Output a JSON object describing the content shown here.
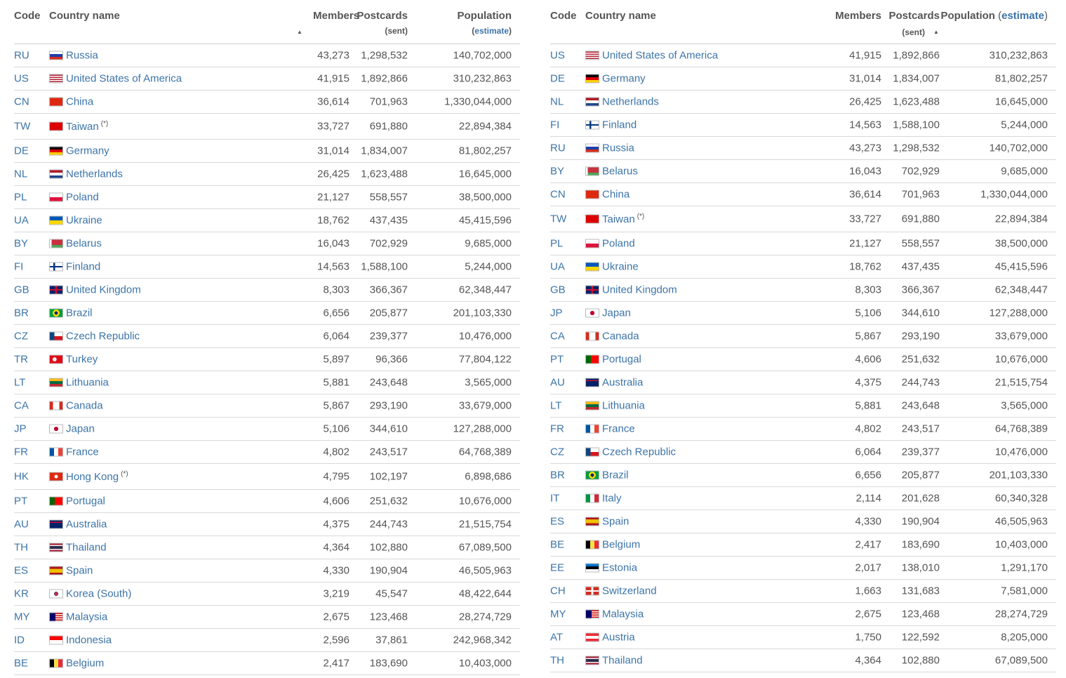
{
  "header": {
    "code": "Code",
    "country": "Country name",
    "members": "Members",
    "postcards": "Postcards",
    "postcards_sub": "(sent)",
    "population": "Population",
    "estimate_open": "(",
    "estimate": "estimate",
    "estimate_close": ")",
    "asc_arrow": "▲"
  },
  "colors": {
    "link": "#3d74a8",
    "text": "#555555",
    "border": "#d9d9d9"
  },
  "left_rows": [
    {
      "code": "RU",
      "country": "Russia",
      "note": "",
      "members": "43,273",
      "postcards": "1,298,532",
      "population": "140,702,000",
      "flag": "flag-russia-icon"
    },
    {
      "code": "US",
      "country": "United States of America",
      "note": "",
      "members": "41,915",
      "postcards": "1,892,866",
      "population": "310,232,863",
      "flag": "flag-usa-icon"
    },
    {
      "code": "CN",
      "country": "China",
      "note": "",
      "members": "36,614",
      "postcards": "701,963",
      "population": "1,330,044,000",
      "flag": "flag-china-icon"
    },
    {
      "code": "TW",
      "country": "Taiwan",
      "note": "(*)",
      "members": "33,727",
      "postcards": "691,880",
      "population": "22,894,384",
      "flag": "flag-taiwan-icon"
    },
    {
      "code": "DE",
      "country": "Germany",
      "note": "",
      "members": "31,014",
      "postcards": "1,834,007",
      "population": "81,802,257",
      "flag": "flag-germany-icon"
    },
    {
      "code": "NL",
      "country": "Netherlands",
      "note": "",
      "members": "26,425",
      "postcards": "1,623,488",
      "population": "16,645,000",
      "flag": "flag-netherlands-icon"
    },
    {
      "code": "PL",
      "country": "Poland",
      "note": "",
      "members": "21,127",
      "postcards": "558,557",
      "population": "38,500,000",
      "flag": "flag-poland-icon"
    },
    {
      "code": "UA",
      "country": "Ukraine",
      "note": "",
      "members": "18,762",
      "postcards": "437,435",
      "population": "45,415,596",
      "flag": "flag-ukraine-icon"
    },
    {
      "code": "BY",
      "country": "Belarus",
      "note": "",
      "members": "16,043",
      "postcards": "702,929",
      "population": "9,685,000",
      "flag": "flag-belarus-icon"
    },
    {
      "code": "FI",
      "country": "Finland",
      "note": "",
      "members": "14,563",
      "postcards": "1,588,100",
      "population": "5,244,000",
      "flag": "flag-finland-icon"
    },
    {
      "code": "GB",
      "country": "United Kingdom",
      "note": "",
      "members": "8,303",
      "postcards": "366,367",
      "population": "62,348,447",
      "flag": "flag-uk-icon"
    },
    {
      "code": "BR",
      "country": "Brazil",
      "note": "",
      "members": "6,656",
      "postcards": "205,877",
      "population": "201,103,330",
      "flag": "flag-brazil-icon"
    },
    {
      "code": "CZ",
      "country": "Czech Republic",
      "note": "",
      "members": "6,064",
      "postcards": "239,377",
      "population": "10,476,000",
      "flag": "flag-czech-icon"
    },
    {
      "code": "TR",
      "country": "Turkey",
      "note": "",
      "members": "5,897",
      "postcards": "96,366",
      "population": "77,804,122",
      "flag": "flag-turkey-icon"
    },
    {
      "code": "LT",
      "country": "Lithuania",
      "note": "",
      "members": "5,881",
      "postcards": "243,648",
      "population": "3,565,000",
      "flag": "flag-lithuania-icon"
    },
    {
      "code": "CA",
      "country": "Canada",
      "note": "",
      "members": "5,867",
      "postcards": "293,190",
      "population": "33,679,000",
      "flag": "flag-canada-icon"
    },
    {
      "code": "JP",
      "country": "Japan",
      "note": "",
      "members": "5,106",
      "postcards": "344,610",
      "population": "127,288,000",
      "flag": "flag-japan-icon"
    },
    {
      "code": "FR",
      "country": "France",
      "note": "",
      "members": "4,802",
      "postcards": "243,517",
      "population": "64,768,389",
      "flag": "flag-france-icon"
    },
    {
      "code": "HK",
      "country": "Hong Kong",
      "note": "(*)",
      "members": "4,795",
      "postcards": "102,197",
      "population": "6,898,686",
      "flag": "flag-hongkong-icon"
    },
    {
      "code": "PT",
      "country": "Portugal",
      "note": "",
      "members": "4,606",
      "postcards": "251,632",
      "population": "10,676,000",
      "flag": "flag-portugal-icon"
    },
    {
      "code": "AU",
      "country": "Australia",
      "note": "",
      "members": "4,375",
      "postcards": "244,743",
      "population": "21,515,754",
      "flag": "flag-australia-icon"
    },
    {
      "code": "TH",
      "country": "Thailand",
      "note": "",
      "members": "4,364",
      "postcards": "102,880",
      "population": "67,089,500",
      "flag": "flag-thailand-icon"
    },
    {
      "code": "ES",
      "country": "Spain",
      "note": "",
      "members": "4,330",
      "postcards": "190,904",
      "population": "46,505,963",
      "flag": "flag-spain-icon"
    },
    {
      "code": "KR",
      "country": "Korea (South)",
      "note": "",
      "members": "3,219",
      "postcards": "45,547",
      "population": "48,422,644",
      "flag": "flag-korea-icon"
    },
    {
      "code": "MY",
      "country": "Malaysia",
      "note": "",
      "members": "2,675",
      "postcards": "123,468",
      "population": "28,274,729",
      "flag": "flag-malaysia-icon"
    },
    {
      "code": "ID",
      "country": "Indonesia",
      "note": "",
      "members": "2,596",
      "postcards": "37,861",
      "population": "242,968,342",
      "flag": "flag-indonesia-icon"
    },
    {
      "code": "BE",
      "country": "Belgium",
      "note": "",
      "members": "2,417",
      "postcards": "183,690",
      "population": "10,403,000",
      "flag": "flag-belgium-icon"
    }
  ],
  "right_rows": [
    {
      "code": "US",
      "country": "United States of America",
      "note": "",
      "members": "41,915",
      "postcards": "1,892,866",
      "population": "310,232,863",
      "flag": "flag-usa-icon"
    },
    {
      "code": "DE",
      "country": "Germany",
      "note": "",
      "members": "31,014",
      "postcards": "1,834,007",
      "population": "81,802,257",
      "flag": "flag-germany-icon"
    },
    {
      "code": "NL",
      "country": "Netherlands",
      "note": "",
      "members": "26,425",
      "postcards": "1,623,488",
      "population": "16,645,000",
      "flag": "flag-netherlands-icon"
    },
    {
      "code": "FI",
      "country": "Finland",
      "note": "",
      "members": "14,563",
      "postcards": "1,588,100",
      "population": "5,244,000",
      "flag": "flag-finland-icon"
    },
    {
      "code": "RU",
      "country": "Russia",
      "note": "",
      "members": "43,273",
      "postcards": "1,298,532",
      "population": "140,702,000",
      "flag": "flag-russia-icon"
    },
    {
      "code": "BY",
      "country": "Belarus",
      "note": "",
      "members": "16,043",
      "postcards": "702,929",
      "population": "9,685,000",
      "flag": "flag-belarus-icon"
    },
    {
      "code": "CN",
      "country": "China",
      "note": "",
      "members": "36,614",
      "postcards": "701,963",
      "population": "1,330,044,000",
      "flag": "flag-china-icon"
    },
    {
      "code": "TW",
      "country": "Taiwan",
      "note": "(*)",
      "members": "33,727",
      "postcards": "691,880",
      "population": "22,894,384",
      "flag": "flag-taiwan-icon"
    },
    {
      "code": "PL",
      "country": "Poland",
      "note": "",
      "members": "21,127",
      "postcards": "558,557",
      "population": "38,500,000",
      "flag": "flag-poland-icon"
    },
    {
      "code": "UA",
      "country": "Ukraine",
      "note": "",
      "members": "18,762",
      "postcards": "437,435",
      "population": "45,415,596",
      "flag": "flag-ukraine-icon"
    },
    {
      "code": "GB",
      "country": "United Kingdom",
      "note": "",
      "members": "8,303",
      "postcards": "366,367",
      "population": "62,348,447",
      "flag": "flag-uk-icon"
    },
    {
      "code": "JP",
      "country": "Japan",
      "note": "",
      "members": "5,106",
      "postcards": "344,610",
      "population": "127,288,000",
      "flag": "flag-japan-icon"
    },
    {
      "code": "CA",
      "country": "Canada",
      "note": "",
      "members": "5,867",
      "postcards": "293,190",
      "population": "33,679,000",
      "flag": "flag-canada-icon"
    },
    {
      "code": "PT",
      "country": "Portugal",
      "note": "",
      "members": "4,606",
      "postcards": "251,632",
      "population": "10,676,000",
      "flag": "flag-portugal-icon"
    },
    {
      "code": "AU",
      "country": "Australia",
      "note": "",
      "members": "4,375",
      "postcards": "244,743",
      "population": "21,515,754",
      "flag": "flag-australia-icon"
    },
    {
      "code": "LT",
      "country": "Lithuania",
      "note": "",
      "members": "5,881",
      "postcards": "243,648",
      "population": "3,565,000",
      "flag": "flag-lithuania-icon"
    },
    {
      "code": "FR",
      "country": "France",
      "note": "",
      "members": "4,802",
      "postcards": "243,517",
      "population": "64,768,389",
      "flag": "flag-france-icon"
    },
    {
      "code": "CZ",
      "country": "Czech Republic",
      "note": "",
      "members": "6,064",
      "postcards": "239,377",
      "population": "10,476,000",
      "flag": "flag-czech-icon"
    },
    {
      "code": "BR",
      "country": "Brazil",
      "note": "",
      "members": "6,656",
      "postcards": "205,877",
      "population": "201,103,330",
      "flag": "flag-brazil-icon"
    },
    {
      "code": "IT",
      "country": "Italy",
      "note": "",
      "members": "2,114",
      "postcards": "201,628",
      "population": "60,340,328",
      "flag": "flag-italy-icon"
    },
    {
      "code": "ES",
      "country": "Spain",
      "note": "",
      "members": "4,330",
      "postcards": "190,904",
      "population": "46,505,963",
      "flag": "flag-spain-icon"
    },
    {
      "code": "BE",
      "country": "Belgium",
      "note": "",
      "members": "2,417",
      "postcards": "183,690",
      "population": "10,403,000",
      "flag": "flag-belgium-icon"
    },
    {
      "code": "EE",
      "country": "Estonia",
      "note": "",
      "members": "2,017",
      "postcards": "138,010",
      "population": "1,291,170",
      "flag": "flag-estonia-icon"
    },
    {
      "code": "CH",
      "country": "Switzerland",
      "note": "",
      "members": "1,663",
      "postcards": "131,683",
      "population": "7,581,000",
      "flag": "flag-switzerland-icon"
    },
    {
      "code": "MY",
      "country": "Malaysia",
      "note": "",
      "members": "2,675",
      "postcards": "123,468",
      "population": "28,274,729",
      "flag": "flag-malaysia-icon"
    },
    {
      "code": "AT",
      "country": "Austria",
      "note": "",
      "members": "1,750",
      "postcards": "122,592",
      "population": "8,205,000",
      "flag": "flag-austria-icon"
    },
    {
      "code": "TH",
      "country": "Thailand",
      "note": "",
      "members": "4,364",
      "postcards": "102,880",
      "population": "67,089,500",
      "flag": "flag-thailand-icon"
    }
  ]
}
